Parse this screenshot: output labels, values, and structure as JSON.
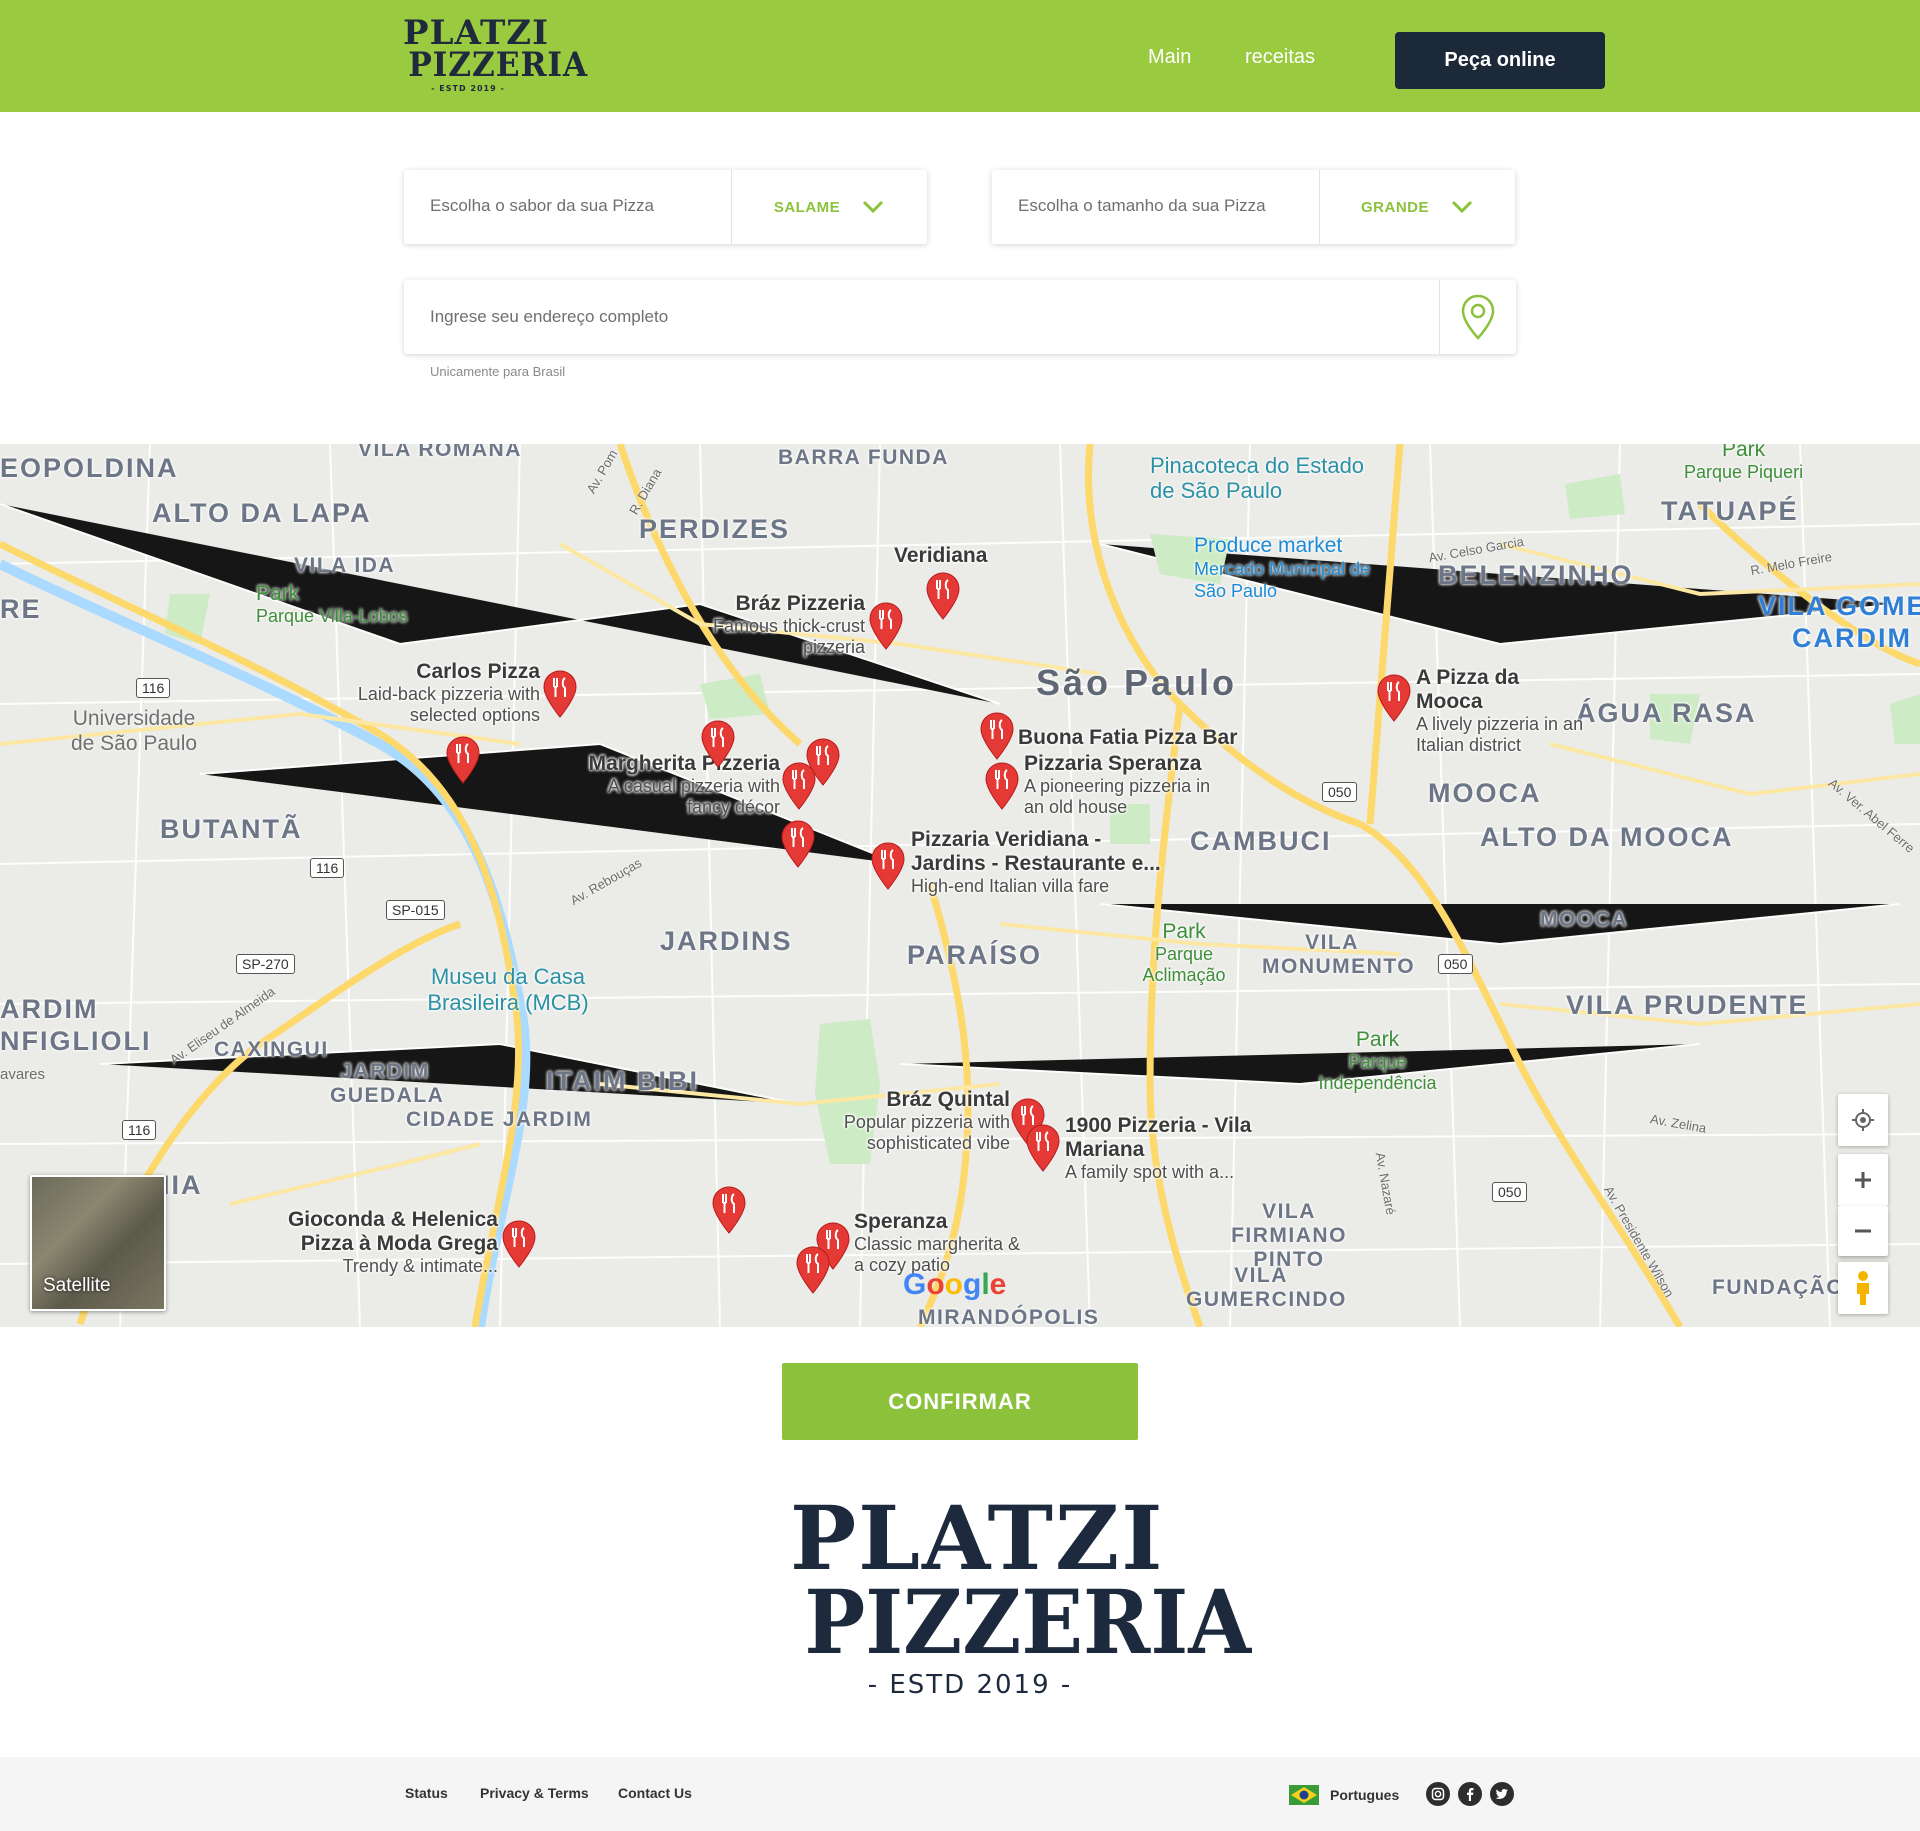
{
  "header": {
    "logo": {
      "line1": "PLATZI",
      "line2": "PIZZERIA",
      "line3": "- ESTD 2019 -"
    },
    "nav": {
      "main": "Main",
      "receitas": "receitas"
    },
    "order_button": "Peça online"
  },
  "form": {
    "flavor": {
      "label": "Escolha o sabor da sua Pizza",
      "value": "SALAME"
    },
    "size": {
      "label": "Escolha o tamanho da sua Pizza",
      "value": "GRANDE"
    },
    "address": {
      "placeholder": "Ingrese seu endereço completo",
      "hint": "Unicamente para Brasil"
    }
  },
  "map": {
    "city": "São Paulo",
    "districts": [
      "EOPOLDINA",
      "VILA ROMANA",
      "BARRA FUNDA",
      "ALTO DA LAPA",
      "PERDIZES",
      "VILA IDA",
      "TATUAPÉ",
      "BELENZINHO",
      "VILA GOME",
      "CARDIM",
      "ÁGUA RASA",
      "MOOCA",
      "ALTO DA MOOCA",
      "CAMBUCI",
      "BUTANTÃ",
      "JARDINS",
      "PARAÍSO",
      "VILA MONUMENTO",
      "VILA PRUDENTE",
      "ARDIM",
      "NFIGLIOLI",
      "CAXINGUI",
      "JARDIM GUEDALA",
      "CIDADE JARDIM",
      "ITAIM BIBI",
      "IIA",
      "VILA FIRMIANO PINTO",
      "VILA GUMERCINDO",
      "MIRANDÓPOLIS",
      "FUNDAÇÃO",
      "MOOCA",
      "RE",
      "VILA"
    ],
    "places": [
      {
        "name": "Veridiana",
        "desc": ""
      },
      {
        "name": "Bráz Pizzeria",
        "desc": "Famous thick-crust pizzeria"
      },
      {
        "name": "Carlos Pizza",
        "desc": "Laid-back pizzeria with selected options"
      },
      {
        "name": "Margherita Pizzeria",
        "desc": "A casual pizzeria with fancy décor"
      },
      {
        "name": "Buona Fatia Pizza Bar",
        "desc": ""
      },
      {
        "name": "Pizzaria Speranza",
        "desc": "A pioneering pizzeria in an old house"
      },
      {
        "name": "Pizzaria Veridiana - Jardins - Restaurante e...",
        "desc": "High-end Italian villa fare"
      },
      {
        "name": "A Pizza da Mooca",
        "desc": "A lively pizzeria in an Italian district"
      },
      {
        "name": "Bráz Quintal",
        "desc": "Popular pizzeria with sophisticated vibe"
      },
      {
        "name": "1900 Pizzeria - Vila Mariana",
        "desc": "A family spot with a..."
      },
      {
        "name": "Gioconda & Helenica Pizza à Moda Grega",
        "desc": "Trendy & intimate..."
      },
      {
        "name": "Speranza",
        "desc": "Classic margherita & a cozy patio"
      }
    ],
    "parks": [
      {
        "name": "Park",
        "desc": "Parque Villa-Lobos"
      },
      {
        "name": "Park",
        "desc": "Parque Piqueri"
      },
      {
        "name": "Park",
        "desc": "Parque Aclimação"
      },
      {
        "name": "Park",
        "desc": "Parque Independência"
      }
    ],
    "pois": {
      "pinacoteca": "Pinacoteca do Estado de São Paulo",
      "produce": "Produce market",
      "mercado": "Mercado Municipal de São Paulo",
      "universidade": "Universidade de São Paulo",
      "museu": "Museu da Casa Brasileira (MCB)"
    },
    "roads": [
      "Av. Pom",
      "R. Diana",
      "Av. Celso Garcia",
      "R. Melo Freire",
      "Av. Rebouças",
      "Av. Eliseu de Almeida",
      "Av. Zelina",
      "Av. Nazaré",
      "Av. Presidente Wilson",
      "Av. Ver. Abel Ferre",
      "avares"
    ],
    "shields": [
      "116",
      "116",
      "116",
      "SP-015",
      "SP-270",
      "050",
      "050",
      "050"
    ],
    "satellite_label": "Satellite",
    "google": "Google"
  },
  "confirm_button": "CONFIRMAR",
  "footer": {
    "links": {
      "status": "Status",
      "privacy": "Privacy & Terms",
      "contact": "Contact Us"
    },
    "language": "Portugues"
  },
  "colors": {
    "brand_green": "#99ca3f",
    "accent_green": "#8cc13c",
    "navy": "#1c2939",
    "pin_red": "#e53935"
  }
}
